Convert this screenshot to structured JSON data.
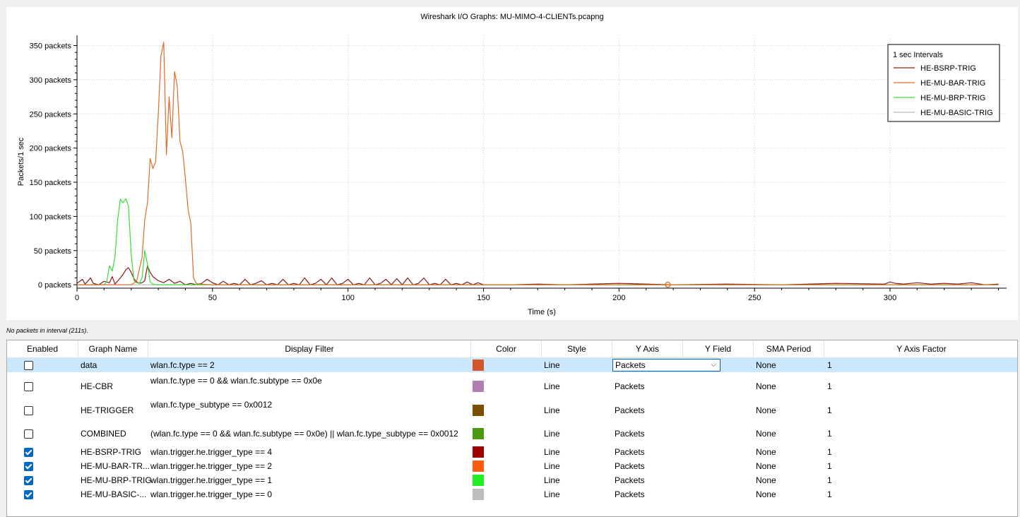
{
  "window": {
    "title": "Wireshark I/O Graphs: MU-MIMO-4-CLIENTs.pcapng"
  },
  "status_hint": "No packets in interval (211s).",
  "chart_data": {
    "type": "line",
    "title": "Wireshark I/O Graphs: MU-MIMO-4-CLIENTs.pcapng",
    "xlabel": "Time (s)",
    "ylabel": "Packets/1 sec",
    "xlim": [
      0,
      343
    ],
    "ylim": [
      -5,
      365
    ],
    "x_ticks": [
      0,
      50,
      100,
      150,
      200,
      250,
      300
    ],
    "y_ticks": [
      0,
      50,
      100,
      150,
      200,
      250,
      300,
      350
    ],
    "y_tick_labels": [
      "0 packets",
      "50 packets",
      "100 packets",
      "150 packets",
      "200 packets",
      "250 packets",
      "300 packets",
      "350 packets"
    ],
    "grid": true,
    "legend_title": "1 sec Intervals",
    "legend_position": "top-right",
    "marker": {
      "x": 218,
      "y": 0,
      "series": "HE-MU-BAR-TRIG"
    },
    "series": [
      {
        "name": "HE-BSRP-TRIG",
        "color": "#8b1a1a",
        "x": [
          0,
          2,
          3,
          5,
          6,
          8,
          10,
          12,
          13,
          14,
          16,
          17,
          18,
          19,
          20,
          21,
          22,
          23,
          24,
          25,
          26,
          27,
          28,
          30,
          32,
          34,
          36,
          38,
          40,
          42,
          44,
          46,
          48,
          50,
          52,
          54,
          56,
          58,
          60,
          62,
          64,
          66,
          68,
          70,
          72,
          74,
          76,
          78,
          80,
          82,
          84,
          86,
          88,
          90,
          92,
          94,
          96,
          98,
          100,
          102,
          104,
          106,
          108,
          110,
          112,
          114,
          116,
          118,
          120,
          122,
          124,
          126,
          128,
          130,
          132,
          134,
          136,
          138,
          140,
          142,
          144,
          146,
          148,
          150,
          160,
          170,
          180,
          200,
          220,
          240,
          260,
          280,
          298,
          300,
          302,
          305,
          310,
          315,
          320,
          325,
          330,
          335,
          340
        ],
        "y": [
          2,
          8,
          1,
          10,
          2,
          0,
          5,
          3,
          12,
          1,
          10,
          15,
          22,
          25,
          18,
          9,
          4,
          2,
          3,
          6,
          28,
          18,
          12,
          6,
          3,
          8,
          2,
          5,
          0,
          2,
          0,
          2,
          8,
          3,
          0,
          5,
          0,
          2,
          0,
          8,
          0,
          2,
          6,
          0,
          2,
          0,
          8,
          0,
          2,
          0,
          10,
          0,
          2,
          8,
          0,
          10,
          0,
          2,
          8,
          0,
          2,
          0,
          10,
          0,
          2,
          8,
          0,
          9,
          0,
          10,
          0,
          2,
          10,
          0,
          2,
          0,
          8,
          0,
          2,
          0,
          4,
          0,
          3,
          0,
          0,
          1,
          0,
          2,
          0,
          1,
          0,
          2,
          1,
          4,
          2,
          1,
          3,
          1,
          2,
          1,
          3,
          0,
          1
        ]
      },
      {
        "name": "HE-MU-BAR-TRIG",
        "color": "#e06a2c",
        "x": [
          0,
          5,
          10,
          15,
          18,
          20,
          22,
          24,
          25,
          26,
          27,
          28,
          29,
          30,
          31,
          32,
          33,
          34,
          35,
          36,
          37,
          38,
          39,
          40,
          41,
          42,
          43,
          44,
          45,
          50,
          100,
          150,
          200,
          218,
          250,
          300,
          340
        ],
        "y": [
          0,
          0,
          0,
          0,
          0,
          0,
          5,
          40,
          95,
          120,
          185,
          170,
          180,
          250,
          335,
          355,
          190,
          275,
          215,
          312,
          290,
          210,
          195,
          155,
          110,
          90,
          10,
          2,
          1,
          0,
          0,
          0,
          0,
          0,
          0,
          0,
          0
        ]
      },
      {
        "name": "HE-MU-BRP-TRIG",
        "color": "#33dd33",
        "x": [
          0,
          10,
          11,
          12,
          13,
          14,
          15,
          16,
          17,
          18,
          19,
          20,
          21,
          22,
          23,
          24,
          25,
          26,
          27,
          28,
          29,
          30,
          40,
          100,
          200,
          340
        ],
        "y": [
          0,
          0,
          5,
          28,
          20,
          40,
          95,
          125,
          120,
          126,
          115,
          45,
          6,
          3,
          2,
          10,
          50,
          30,
          4,
          1,
          0,
          0,
          0,
          0,
          0,
          0
        ]
      },
      {
        "name": "HE-MU-BASIC-TRIG",
        "color": "#b8b8b8",
        "x": [
          0,
          100,
          200,
          300,
          340
        ],
        "y": [
          0,
          0,
          0,
          0,
          0
        ]
      }
    ]
  },
  "table": {
    "headers": [
      "Enabled",
      "Graph Name",
      "Display Filter",
      "Color",
      "Style",
      "Y Axis",
      "Y Field",
      "SMA Period",
      "Y Axis Factor"
    ],
    "rows": [
      {
        "enabled": false,
        "name": "data",
        "filter": "wlan.fc.type == 2",
        "color": "#d0582b",
        "style": "Line",
        "y_axis": "Packets",
        "sma": "None",
        "factor": "1",
        "selected": true
      },
      {
        "enabled": false,
        "name": "HE-CBR",
        "filter": "wlan.fc.type == 0 && wlan.fc.subtype == 0x0e",
        "color": "#b07fb0",
        "style": "Line",
        "y_axis": "Packets",
        "sma": "None",
        "factor": "1"
      },
      {
        "enabled": false,
        "name": "HE-TRIGGER",
        "filter": "wlan.fc.type_subtype == 0x0012",
        "color": "#7a5000",
        "style": "Line",
        "y_axis": "Packets",
        "sma": "None",
        "factor": "1"
      },
      {
        "enabled": false,
        "name": "COMBINED",
        "filter": "(wlan.fc.type == 0 && wlan.fc.subtype == 0x0e) || wlan.fc.type_subtype == 0x0012",
        "color": "#4a9a10",
        "style": "Line",
        "y_axis": "Packets",
        "sma": "None",
        "factor": "1"
      },
      {
        "enabled": true,
        "name": "HE-BSRP-TRIG",
        "filter": "wlan.trigger.he.trigger_type == 4",
        "color": "#a00000",
        "style": "Line",
        "y_axis": "Packets",
        "sma": "None",
        "factor": "1"
      },
      {
        "enabled": true,
        "name": "HE-MU-BAR-TR...",
        "filter": "wlan.trigger.he.trigger_type == 2",
        "color": "#ff5a10",
        "style": "Line",
        "y_axis": "Packets",
        "sma": "None",
        "factor": "1"
      },
      {
        "enabled": true,
        "name": "HE-MU-BRP-TRIG",
        "filter": "wlan.trigger.he.trigger_type == 1",
        "color": "#22ee22",
        "style": "Line",
        "y_axis": "Packets",
        "sma": "None",
        "factor": "1"
      },
      {
        "enabled": true,
        "name": "HE-MU-BASIC-...",
        "filter": "wlan.trigger.he.trigger_type == 0",
        "color": "#bdbdbd",
        "style": "Line",
        "y_axis": "Packets",
        "sma": "None",
        "factor": "1"
      }
    ]
  }
}
